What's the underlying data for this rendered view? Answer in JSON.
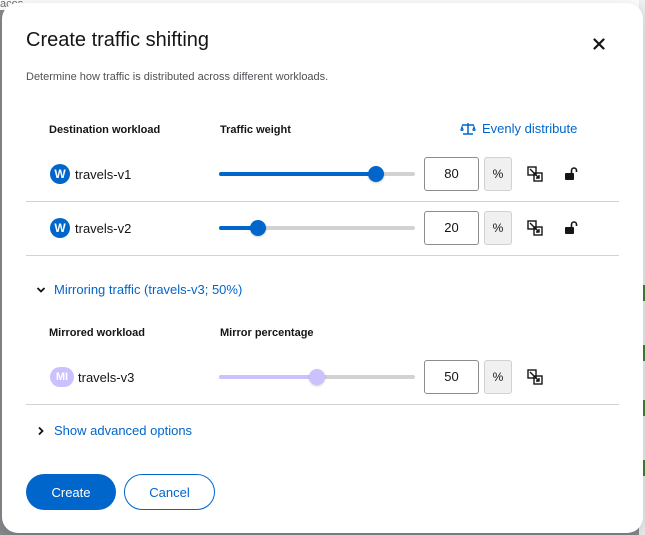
{
  "backdrop": {
    "partial_text": "aces"
  },
  "modal": {
    "title": "Create traffic shifting",
    "description": "Determine how traffic is distributed across different workloads."
  },
  "traffic": {
    "col_workload": "Destination workload",
    "col_weight": "Traffic weight",
    "evenly_label": "Evenly distribute",
    "rows": [
      {
        "badge": "W",
        "name": "travels-v1",
        "weight": 80,
        "unit": "%",
        "locked": false
      },
      {
        "badge": "W",
        "name": "travels-v2",
        "weight": 20,
        "unit": "%",
        "locked": false
      }
    ]
  },
  "mirroring": {
    "toggle_label": "Mirroring traffic (travels-v3; 50%)",
    "expanded": true,
    "col_workload": "Mirrored workload",
    "col_percentage": "Mirror percentage",
    "row": {
      "badge": "MI",
      "name": "travels-v3",
      "percentage": 50,
      "unit": "%"
    }
  },
  "advanced": {
    "toggle_label": "Show advanced options",
    "expanded": false
  },
  "actions": {
    "create_label": "Create",
    "cancel_label": "Cancel"
  },
  "colors": {
    "primary": "#0066cc",
    "mirror": "#cbc1ff",
    "border": "#d2d2d2",
    "text": "#151515"
  },
  "icons": {
    "close": "close-icon",
    "balance": "balance-scale-icon",
    "unlock": "unlock-icon",
    "connect": "connect-icon",
    "chevron_down": "chevron-down-icon",
    "chevron_right": "chevron-right-icon"
  }
}
